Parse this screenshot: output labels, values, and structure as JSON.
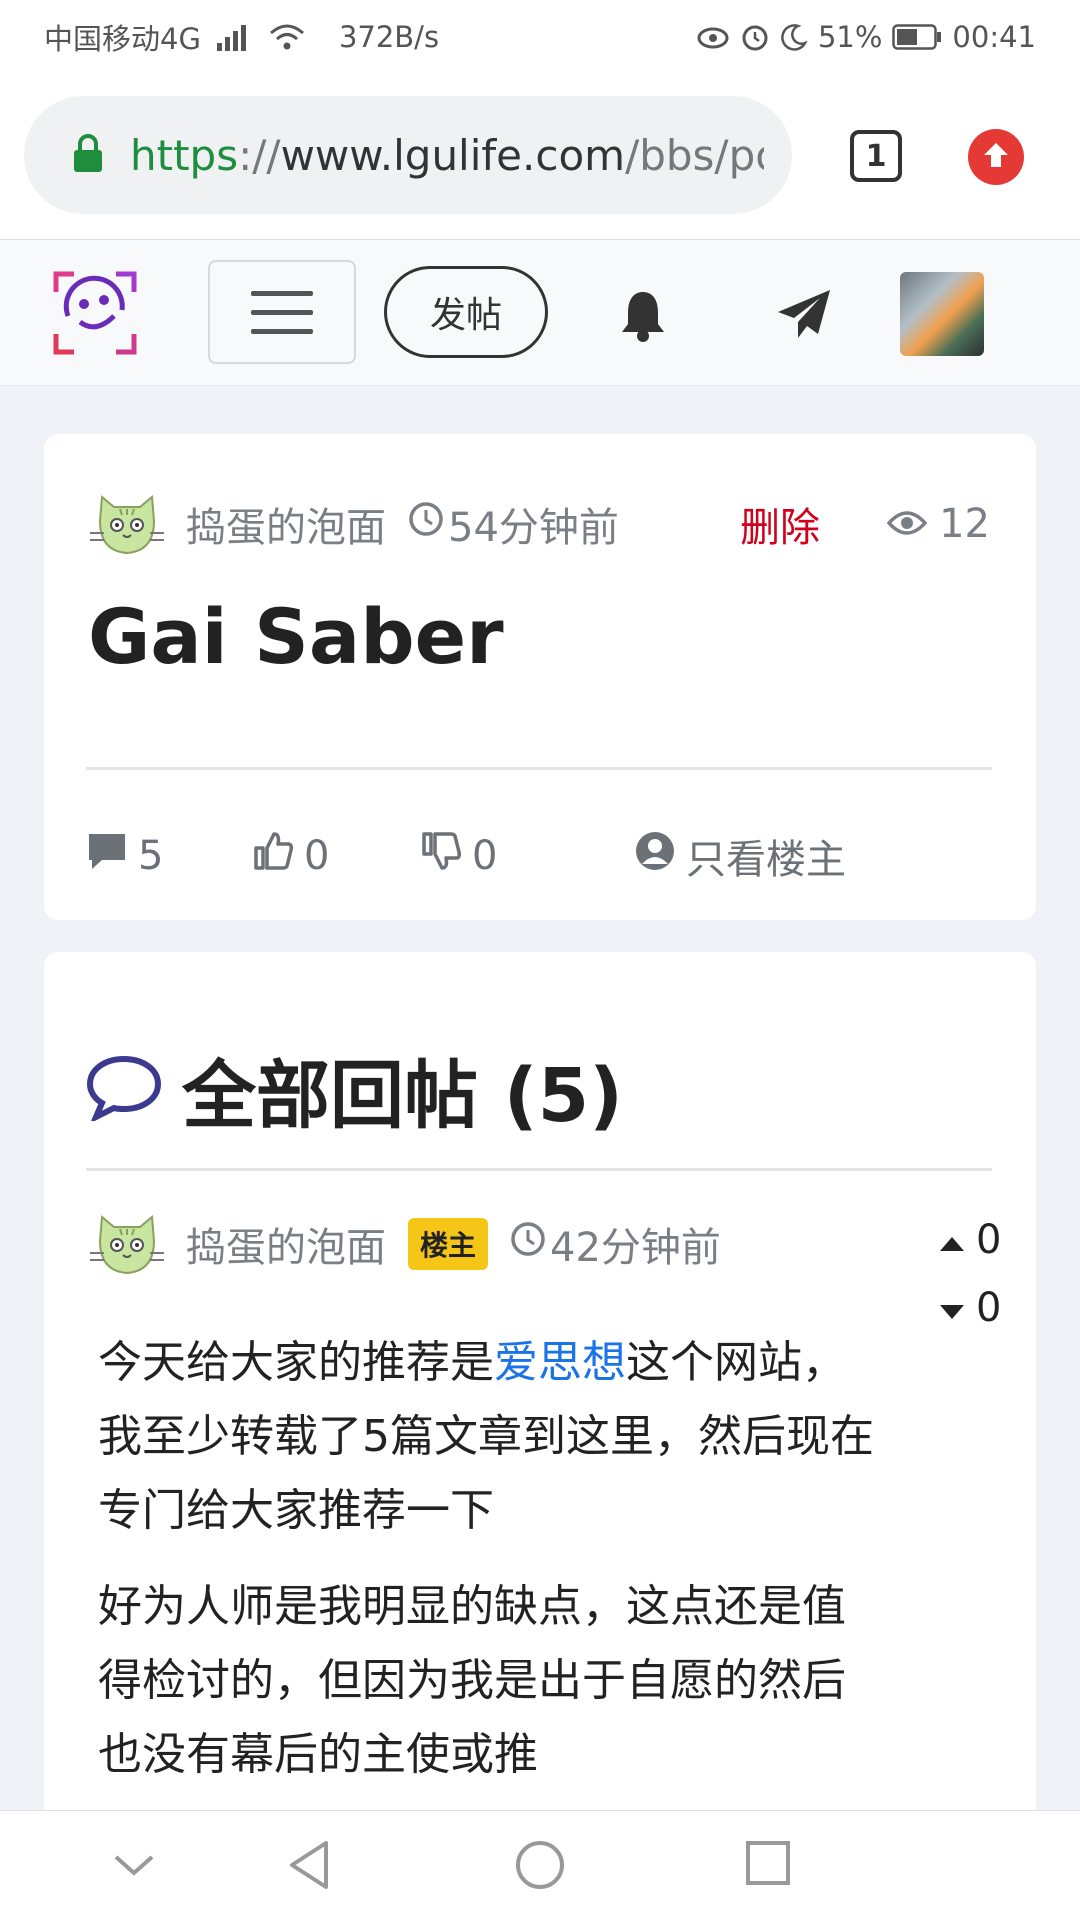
{
  "status_bar": {
    "carrier": "中国移动4G",
    "net_type": "4G",
    "speed": "372B/s",
    "battery": "51%",
    "time": "00:41"
  },
  "browser": {
    "url_scheme": "https",
    "url_sep": "://",
    "url_host": "www.lgulife.com",
    "url_path": "/bbs/po",
    "tab_count": "1"
  },
  "site_nav": {
    "post_label": "发帖"
  },
  "post": {
    "author": "捣蛋的泡面",
    "time": "54分钟前",
    "delete_label": "删除",
    "views": "12",
    "title": "Gai Saber",
    "comments": "5",
    "likes": "0",
    "dislikes": "0",
    "only_op_label": "只看楼主"
  },
  "replies": {
    "header": "全部回帖 (5)",
    "items": [
      {
        "author": "捣蛋的泡面",
        "badge": "楼主",
        "time": "42分钟前",
        "up": "0",
        "down": "0",
        "p1_before": "今天给大家的推荐是",
        "p1_link": "爱思想",
        "p1_after": "这个网站，我至少转载了5篇文章到这里，然后现在专门给大家推荐一下",
        "p2": "好为人师是我明显的缺点，这点还是值得检讨的，但因为我是出于自愿的然后也没有幕后的主使或推"
      }
    ]
  },
  "colors": {
    "delete_red": "#d0021b",
    "link_blue": "#1a73e8",
    "op_badge": "#f5c518",
    "reply_icon": "#3c3a8f"
  }
}
